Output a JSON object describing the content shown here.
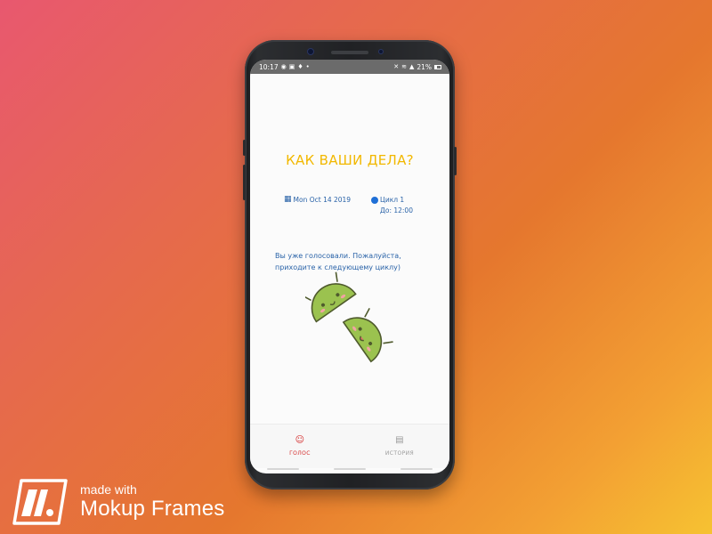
{
  "status_bar": {
    "time": "10:17",
    "left_icons": [
      "whatsapp-icon",
      "image-icon",
      "mic-icon",
      "dot-icon"
    ],
    "right_icons": [
      "mute-icon",
      "wifi-icon",
      "signal-icon"
    ],
    "battery_percent": "21%"
  },
  "main": {
    "title": "КАК ВАШИ ДЕЛА?",
    "date": "Mon Oct 14 2019",
    "cycle": "Цикл 1",
    "until": "До: 12:00",
    "message": "Вы уже голосовали. Пожалуйста, приходите к следующему циклу)"
  },
  "bottom_nav": {
    "items": [
      {
        "label": "ГОЛОС",
        "icon": "smiley-icon",
        "active": true
      },
      {
        "label": "ИСТОРИЯ",
        "icon": "document-icon",
        "active": false
      }
    ],
    "active_color": "#d42a2a",
    "inactive_color": "#9a9a9a"
  },
  "watermark": {
    "line1": "made with",
    "line2": "Mokup Frames"
  },
  "colors": {
    "title": "#f2b800",
    "text_blue": "#2a63a8",
    "android_green": "#9bc24f"
  }
}
